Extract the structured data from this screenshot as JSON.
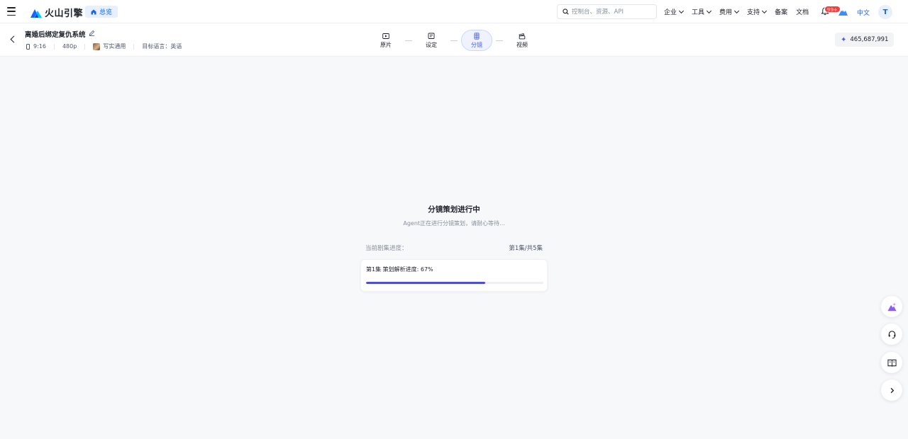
{
  "topnav": {
    "logo_text": "火山引擎",
    "overview_label": "总览",
    "search_placeholder": "控制台、资源、API",
    "items": [
      {
        "label": "企业",
        "has_menu": true
      },
      {
        "label": "工具",
        "has_menu": true
      },
      {
        "label": "费用",
        "has_menu": true
      },
      {
        "label": "支持",
        "has_menu": true
      },
      {
        "label": "备案",
        "has_menu": false
      },
      {
        "label": "文档",
        "has_menu": false
      }
    ],
    "notification_badge": "99+",
    "language": "中文",
    "avatar_letter": "T"
  },
  "project": {
    "title": "离婚后绑定复仇系统",
    "aspect_ratio": "9:16",
    "resolution": "480p",
    "style": "写实通用",
    "target_language": "目标语言：英语"
  },
  "steps": [
    {
      "label": "原片",
      "icon": "play-icon",
      "active": false
    },
    {
      "label": "设定",
      "icon": "settings-doc-icon",
      "active": false
    },
    {
      "label": "分镜",
      "icon": "storyboard-icon",
      "active": true
    },
    {
      "label": "视频",
      "icon": "video-icon",
      "active": false
    }
  ],
  "credits": "465,687,991",
  "main": {
    "title": "分镜策划进行中",
    "subtitle": "Agent正在进行分镜策划，请耐心等待...",
    "progress_label": "当前剧集进度：",
    "progress_value": "第1集/共5集",
    "card_label": "第1集 策划解析进度: 67%",
    "card_progress": 0.67
  },
  "colors": {
    "accent": "#4a4fd6",
    "brand_blue": "#1664ff",
    "badge_red": "#f53f3f"
  },
  "fabs": [
    "ai-assistant-icon",
    "support-icon",
    "book-icon",
    "chevron-right-icon"
  ]
}
